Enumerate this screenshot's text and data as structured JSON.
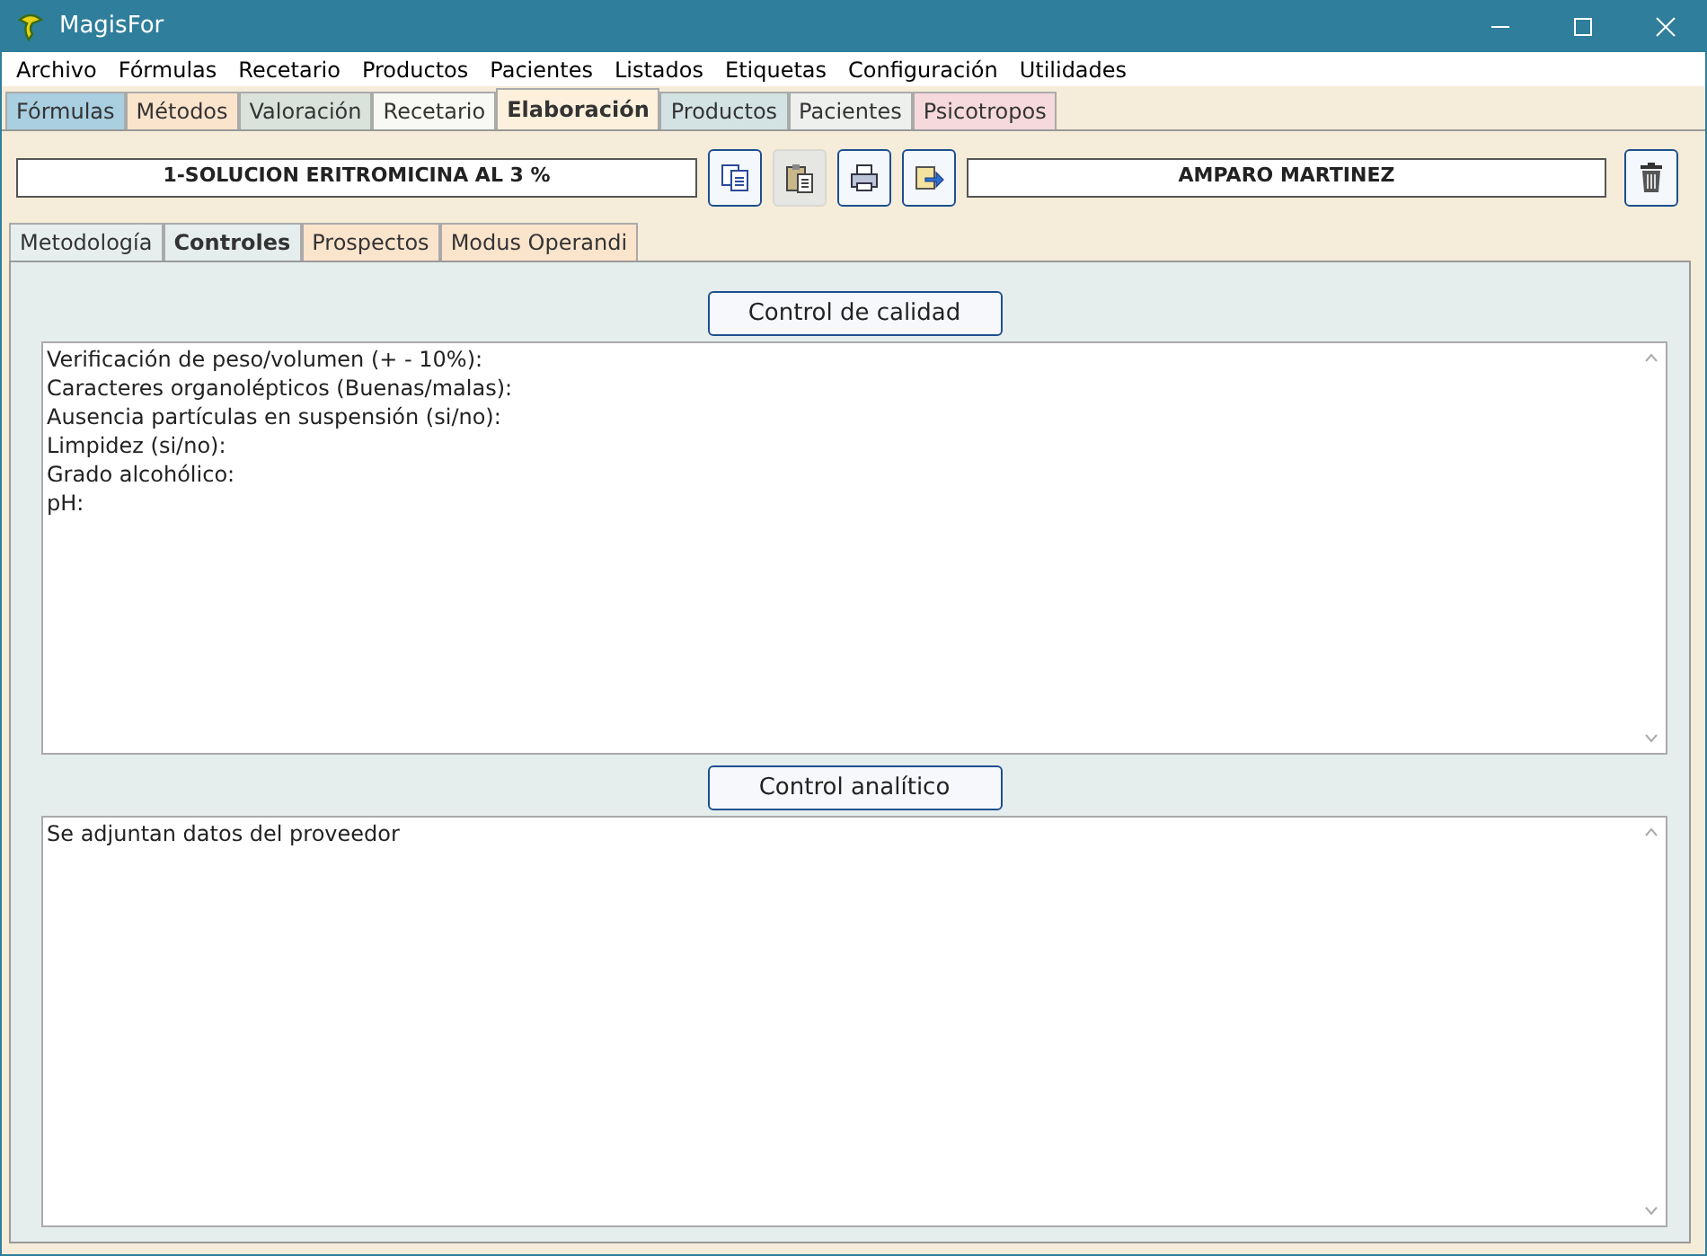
{
  "window": {
    "title": "MagisFor"
  },
  "menu": [
    "Archivo",
    "Fórmulas",
    "Recetario",
    "Productos",
    "Pacientes",
    "Listados",
    "Etiquetas",
    "Configuración",
    "Utilidades"
  ],
  "tabs": [
    {
      "label": "Fórmulas",
      "selected": false,
      "color": "#a9cfe0"
    },
    {
      "label": "Métodos",
      "selected": false,
      "color": "#fbe4cc"
    },
    {
      "label": "Valoración",
      "selected": false,
      "color": "#d9e3dc"
    },
    {
      "label": "Recetario",
      "selected": false,
      "color": "#f8f8f4"
    },
    {
      "label": "Elaboración",
      "selected": true,
      "color": "#fdf0dc"
    },
    {
      "label": "Productos",
      "selected": false,
      "color": "#d3e3e3"
    },
    {
      "label": "Pacientes",
      "selected": false,
      "color": "#eef0ee"
    },
    {
      "label": "Psicotropos",
      "selected": false,
      "color": "#f6d9dc"
    }
  ],
  "formula_field": {
    "value": "1-SOLUCION ERITROMICINA AL 3 %"
  },
  "toolbar": [
    {
      "kind": "copy",
      "disabled": false
    },
    {
      "kind": "paste",
      "disabled": true
    },
    {
      "kind": "print",
      "disabled": false
    },
    {
      "kind": "export",
      "disabled": false
    }
  ],
  "patient_field": {
    "value": "AMPARO MARTINEZ"
  },
  "subtabs": [
    {
      "label": "Metodología",
      "selected": false,
      "color": "#e6eeee"
    },
    {
      "label": "Controles",
      "selected": true,
      "color": "#e6eeed"
    },
    {
      "label": "Prospectos",
      "selected": false,
      "color": "#fbe4cc"
    },
    {
      "label": "Modus Operandi",
      "selected": false,
      "color": "#fbe4cc"
    }
  ],
  "sections": [
    {
      "button": "Control de calidad",
      "lines": [
        "Verificación de peso/volumen (+ - 10%):",
        "Caracteres organolépticos (Buenas/malas):",
        "Ausencia partículas en suspensión (si/no):",
        "Limpidez (si/no):",
        "Grado alcohólico:",
        "pH:"
      ]
    },
    {
      "button": "Control analítico",
      "lines": [
        "Se adjuntan datos del proveedor"
      ]
    }
  ]
}
